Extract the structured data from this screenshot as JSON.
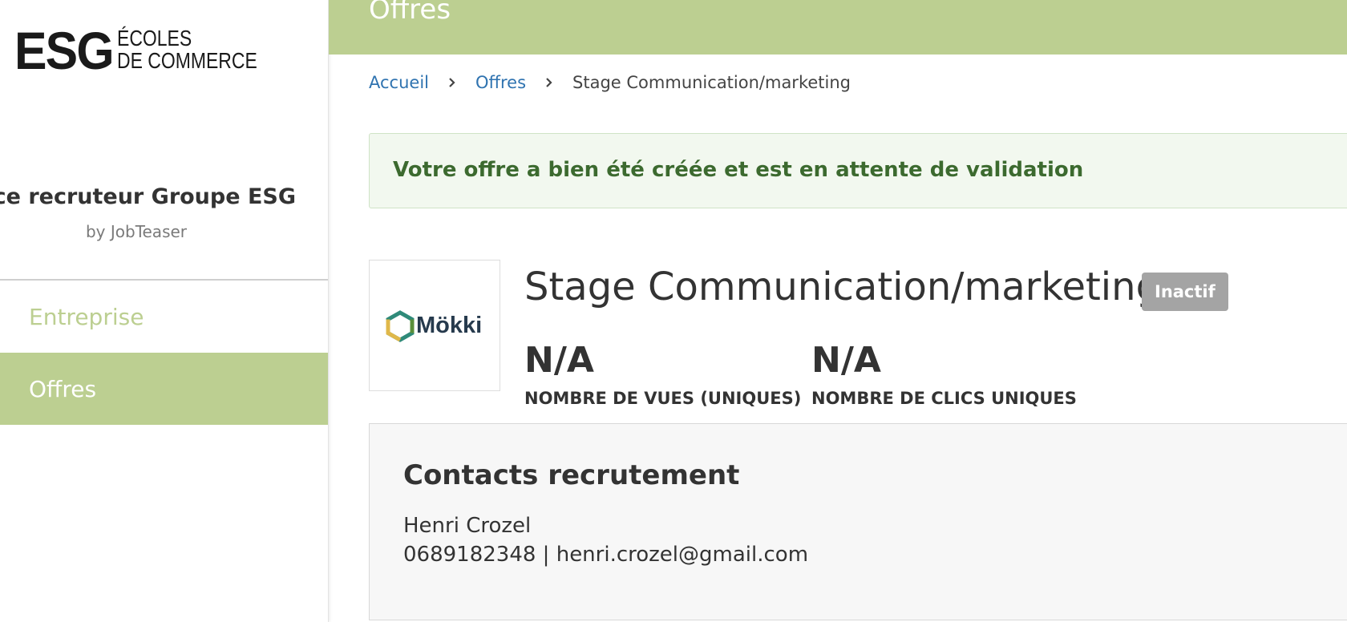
{
  "sidebar": {
    "logo": {
      "mark": "ESG",
      "line1": "ÉCOLES",
      "line2": "DE COMMERCE"
    },
    "space_title": "pace recruteur Groupe ESG",
    "space_subtitle": "by JobTeaser",
    "nav": [
      {
        "label": "Entreprise",
        "active": false
      },
      {
        "label": "Offres",
        "active": true
      }
    ]
  },
  "header": {
    "title": "Offres"
  },
  "breadcrumb": {
    "items": [
      "Accueil",
      "Offres"
    ],
    "current": "Stage Communication/marketing"
  },
  "alert": {
    "message": "Votre offre a bien été créée et est en attente de validation"
  },
  "offer": {
    "company_logo_text": "Mökki",
    "title": "Stage Communication/marketing",
    "status": "Inactif",
    "stats": [
      {
        "value": "N/A",
        "label": "NOMBRE DE VUES (UNIQUES)"
      },
      {
        "value": "N/A",
        "label": "NOMBRE DE CLICS UNIQUES"
      }
    ]
  },
  "contacts": {
    "title": "Contacts recrutement",
    "name": "Henri Crozel",
    "details": "0689182348 | henri.crozel@gmail.com"
  },
  "colors": {
    "brand_green": "#bccf91",
    "link_blue": "#2f73b0",
    "alert_text": "#3c6a2f",
    "badge_gray": "#a4a4a4"
  }
}
